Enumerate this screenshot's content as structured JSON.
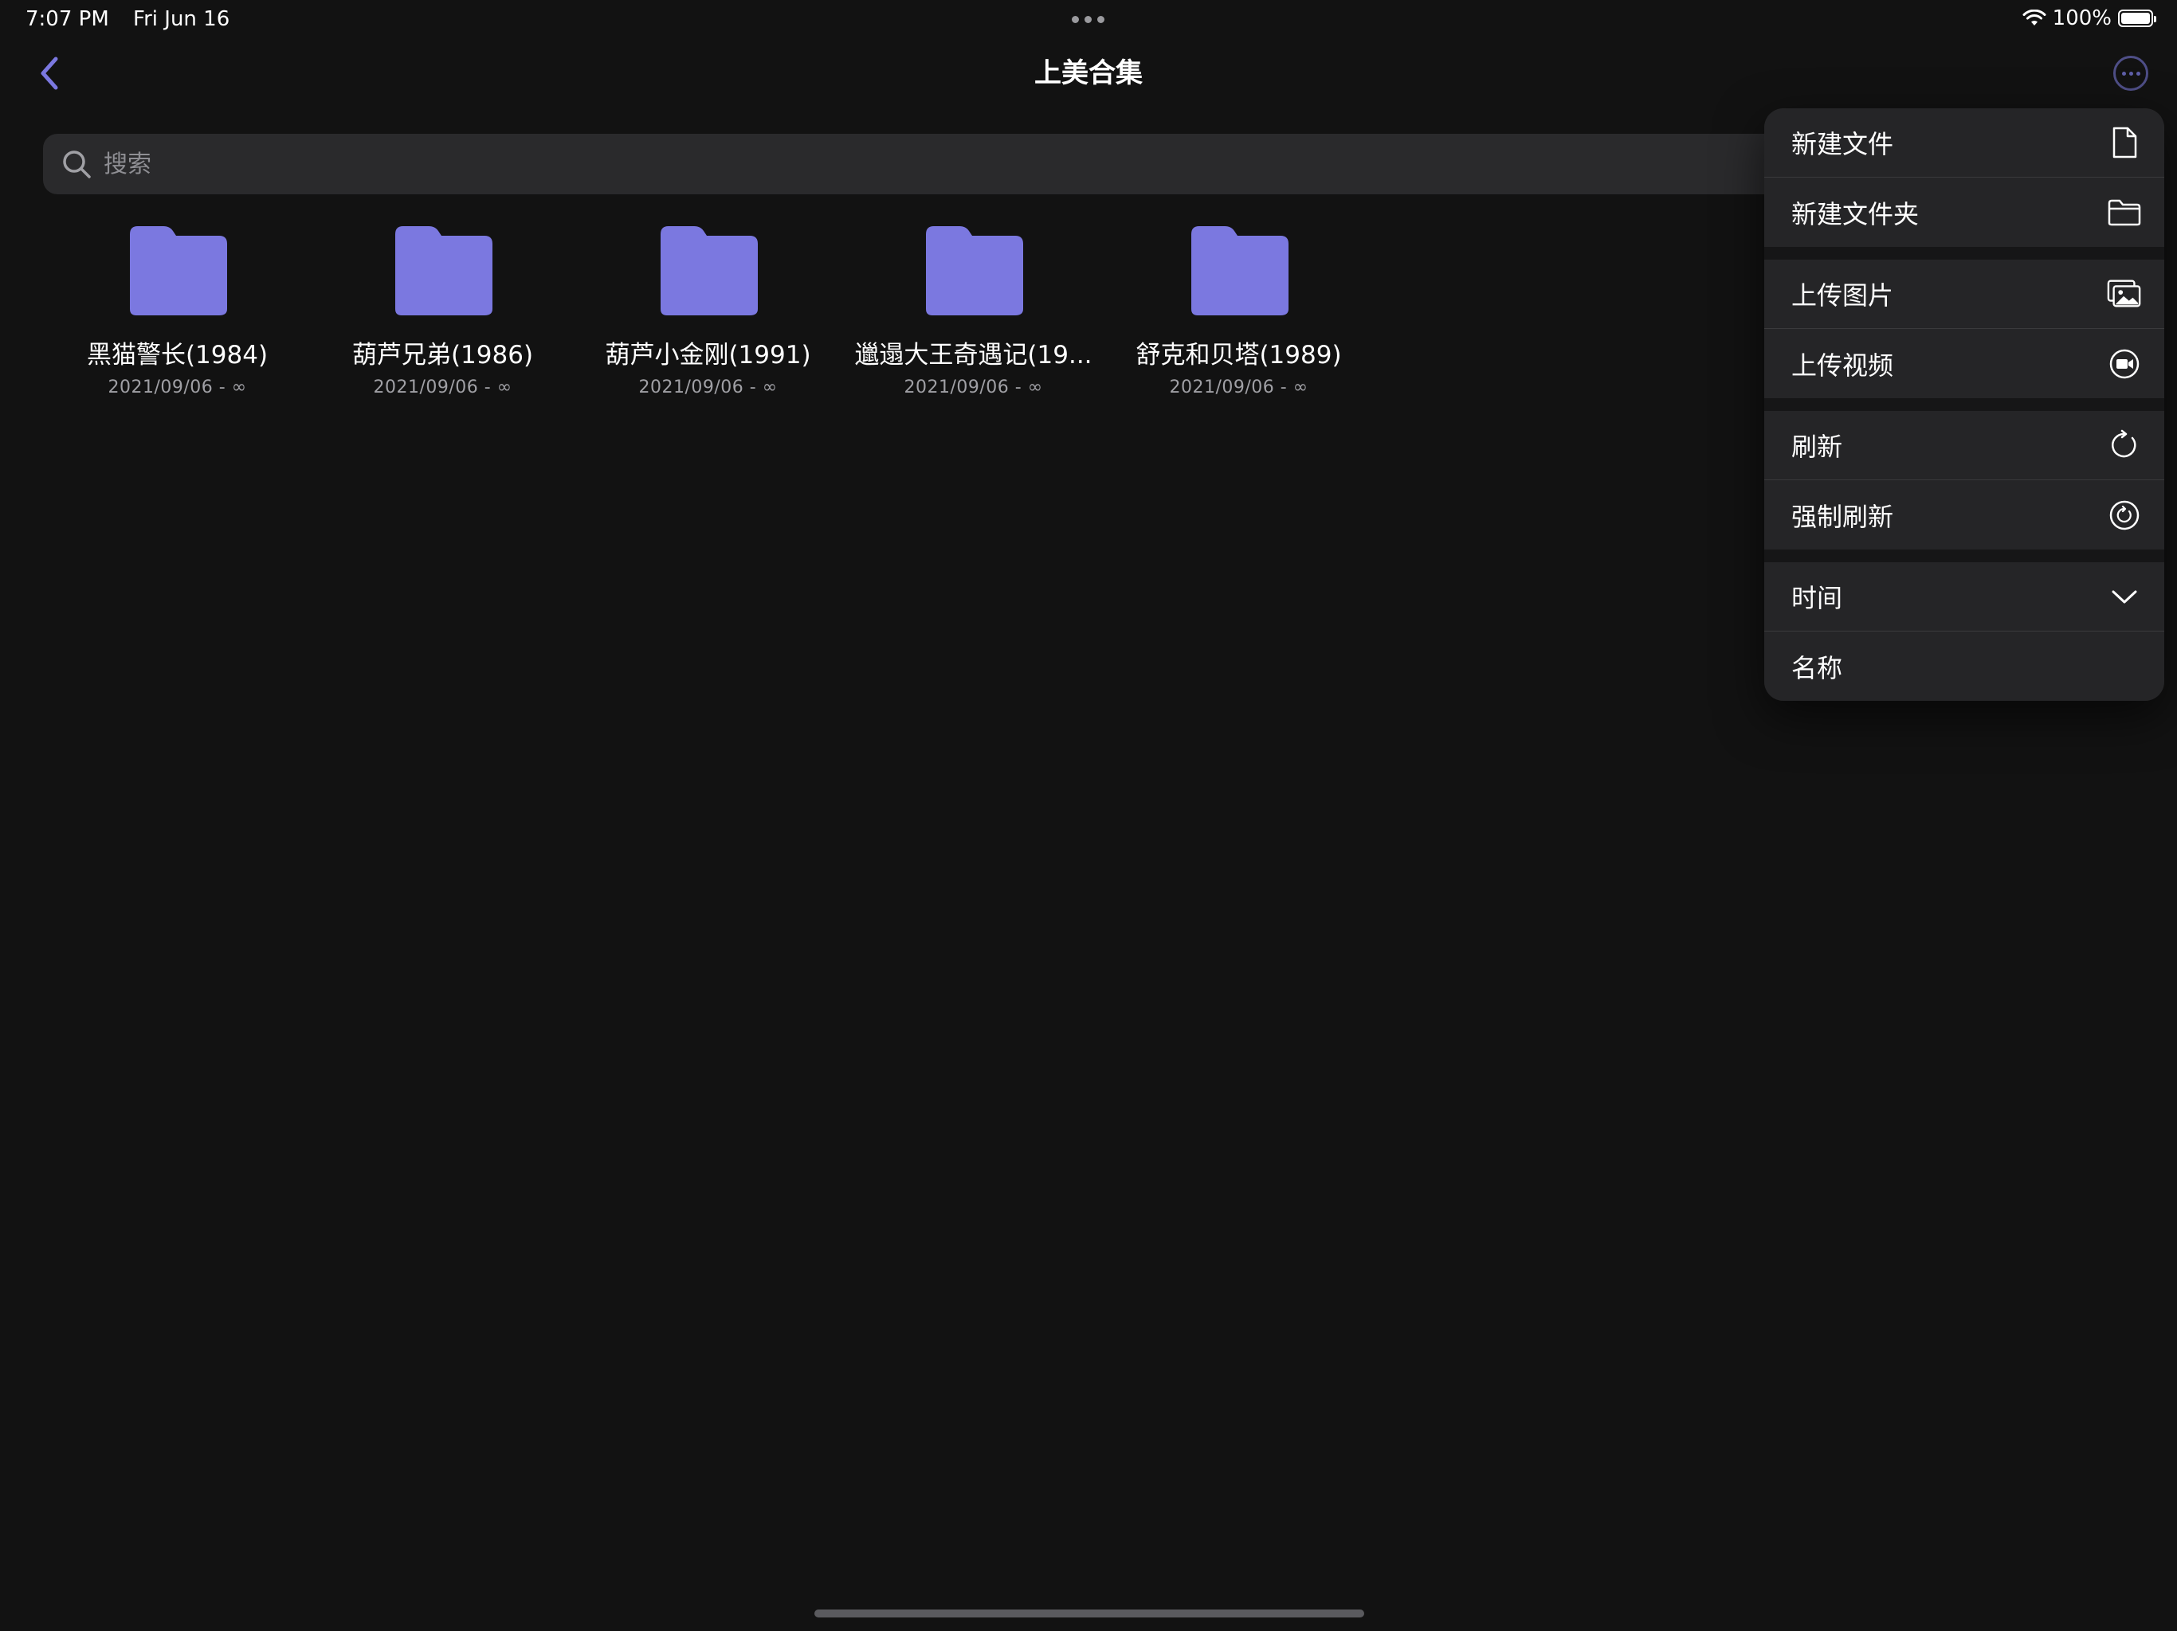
{
  "status_bar": {
    "time": "7:07 PM",
    "date": "Fri Jun 16",
    "battery": "100%",
    "wifi_icon": "wifi-icon",
    "battery_icon": "battery-icon"
  },
  "nav": {
    "title": "上美合集",
    "back_icon": "chevron-left-icon",
    "more_icon": "ellipsis-circle-icon"
  },
  "search": {
    "placeholder": "搜索",
    "value": ""
  },
  "folders": [
    {
      "name": "黑猫警长(1984)",
      "meta": "2021/09/06 - ∞"
    },
    {
      "name": "葫芦兄弟(1986)",
      "meta": "2021/09/06 - ∞"
    },
    {
      "name": "葫芦小金刚(1991)",
      "meta": "2021/09/06 - ∞"
    },
    {
      "name": "邋遢大王奇遇记(19...",
      "meta": "2021/09/06 - ∞"
    },
    {
      "name": "舒克和贝塔(1989)",
      "meta": "2021/09/06 - ∞"
    }
  ],
  "menu": {
    "groups": [
      [
        {
          "label": "新建文件",
          "icon": "document-icon"
        },
        {
          "label": "新建文件夹",
          "icon": "folder-icon"
        }
      ],
      [
        {
          "label": "上传图片",
          "icon": "photos-icon"
        },
        {
          "label": "上传视频",
          "icon": "video-circle-icon"
        }
      ],
      [
        {
          "label": "刷新",
          "icon": "refresh-icon"
        },
        {
          "label": "强制刷新",
          "icon": "force-refresh-icon"
        }
      ],
      [
        {
          "label": "时间",
          "icon": "chevron-down-icon"
        },
        {
          "label": "名称",
          "icon": ""
        }
      ]
    ]
  },
  "colors": {
    "background": "#121212",
    "accent": "#7b78e0",
    "menu_bg": "#252527"
  }
}
